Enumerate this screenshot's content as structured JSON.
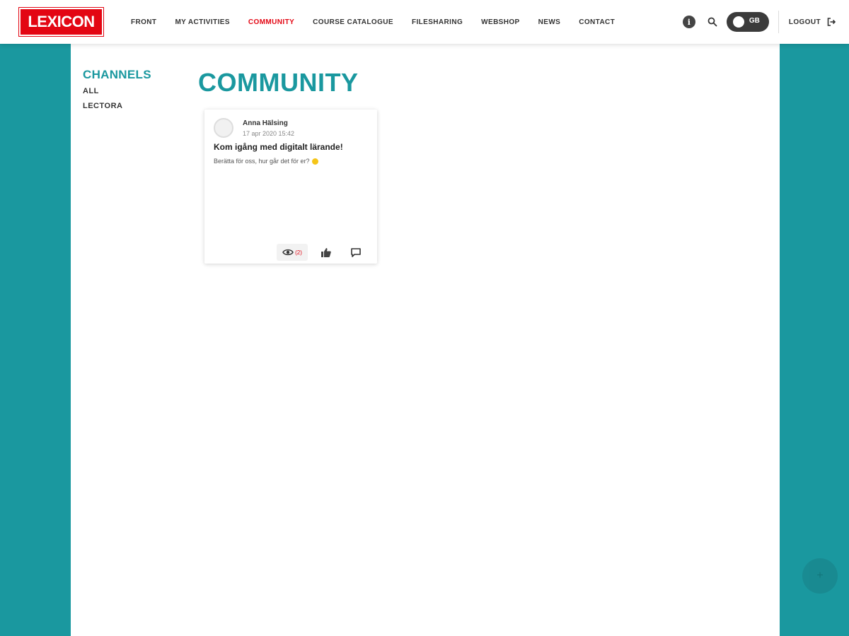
{
  "header": {
    "logo_text": "LEXICON",
    "nav": [
      "FRONT",
      "MY ACTIVITIES",
      "COMMUNITY",
      "COURSE CATALOGUE",
      "FILESHARING",
      "WEBSHOP",
      "NEWS",
      "CONTACT"
    ],
    "active_nav": "COMMUNITY",
    "lang_label": "GB",
    "logout_label": "LOGOUT"
  },
  "sidebar": {
    "title": "CHANNELS",
    "items": [
      "ALL",
      "LECTORA"
    ]
  },
  "main": {
    "title": "COMMUNITY"
  },
  "post": {
    "author": "Anna Hälsing",
    "timestamp": "17 apr 2020 15:42",
    "title": "Kom igång med digitalt lärande!",
    "body": "Berätta för oss, hur går det för er?",
    "views": "(2)"
  },
  "fab": {
    "symbol": "+"
  },
  "colors": {
    "brand_red": "#e30613",
    "teal": "#1a989f"
  }
}
